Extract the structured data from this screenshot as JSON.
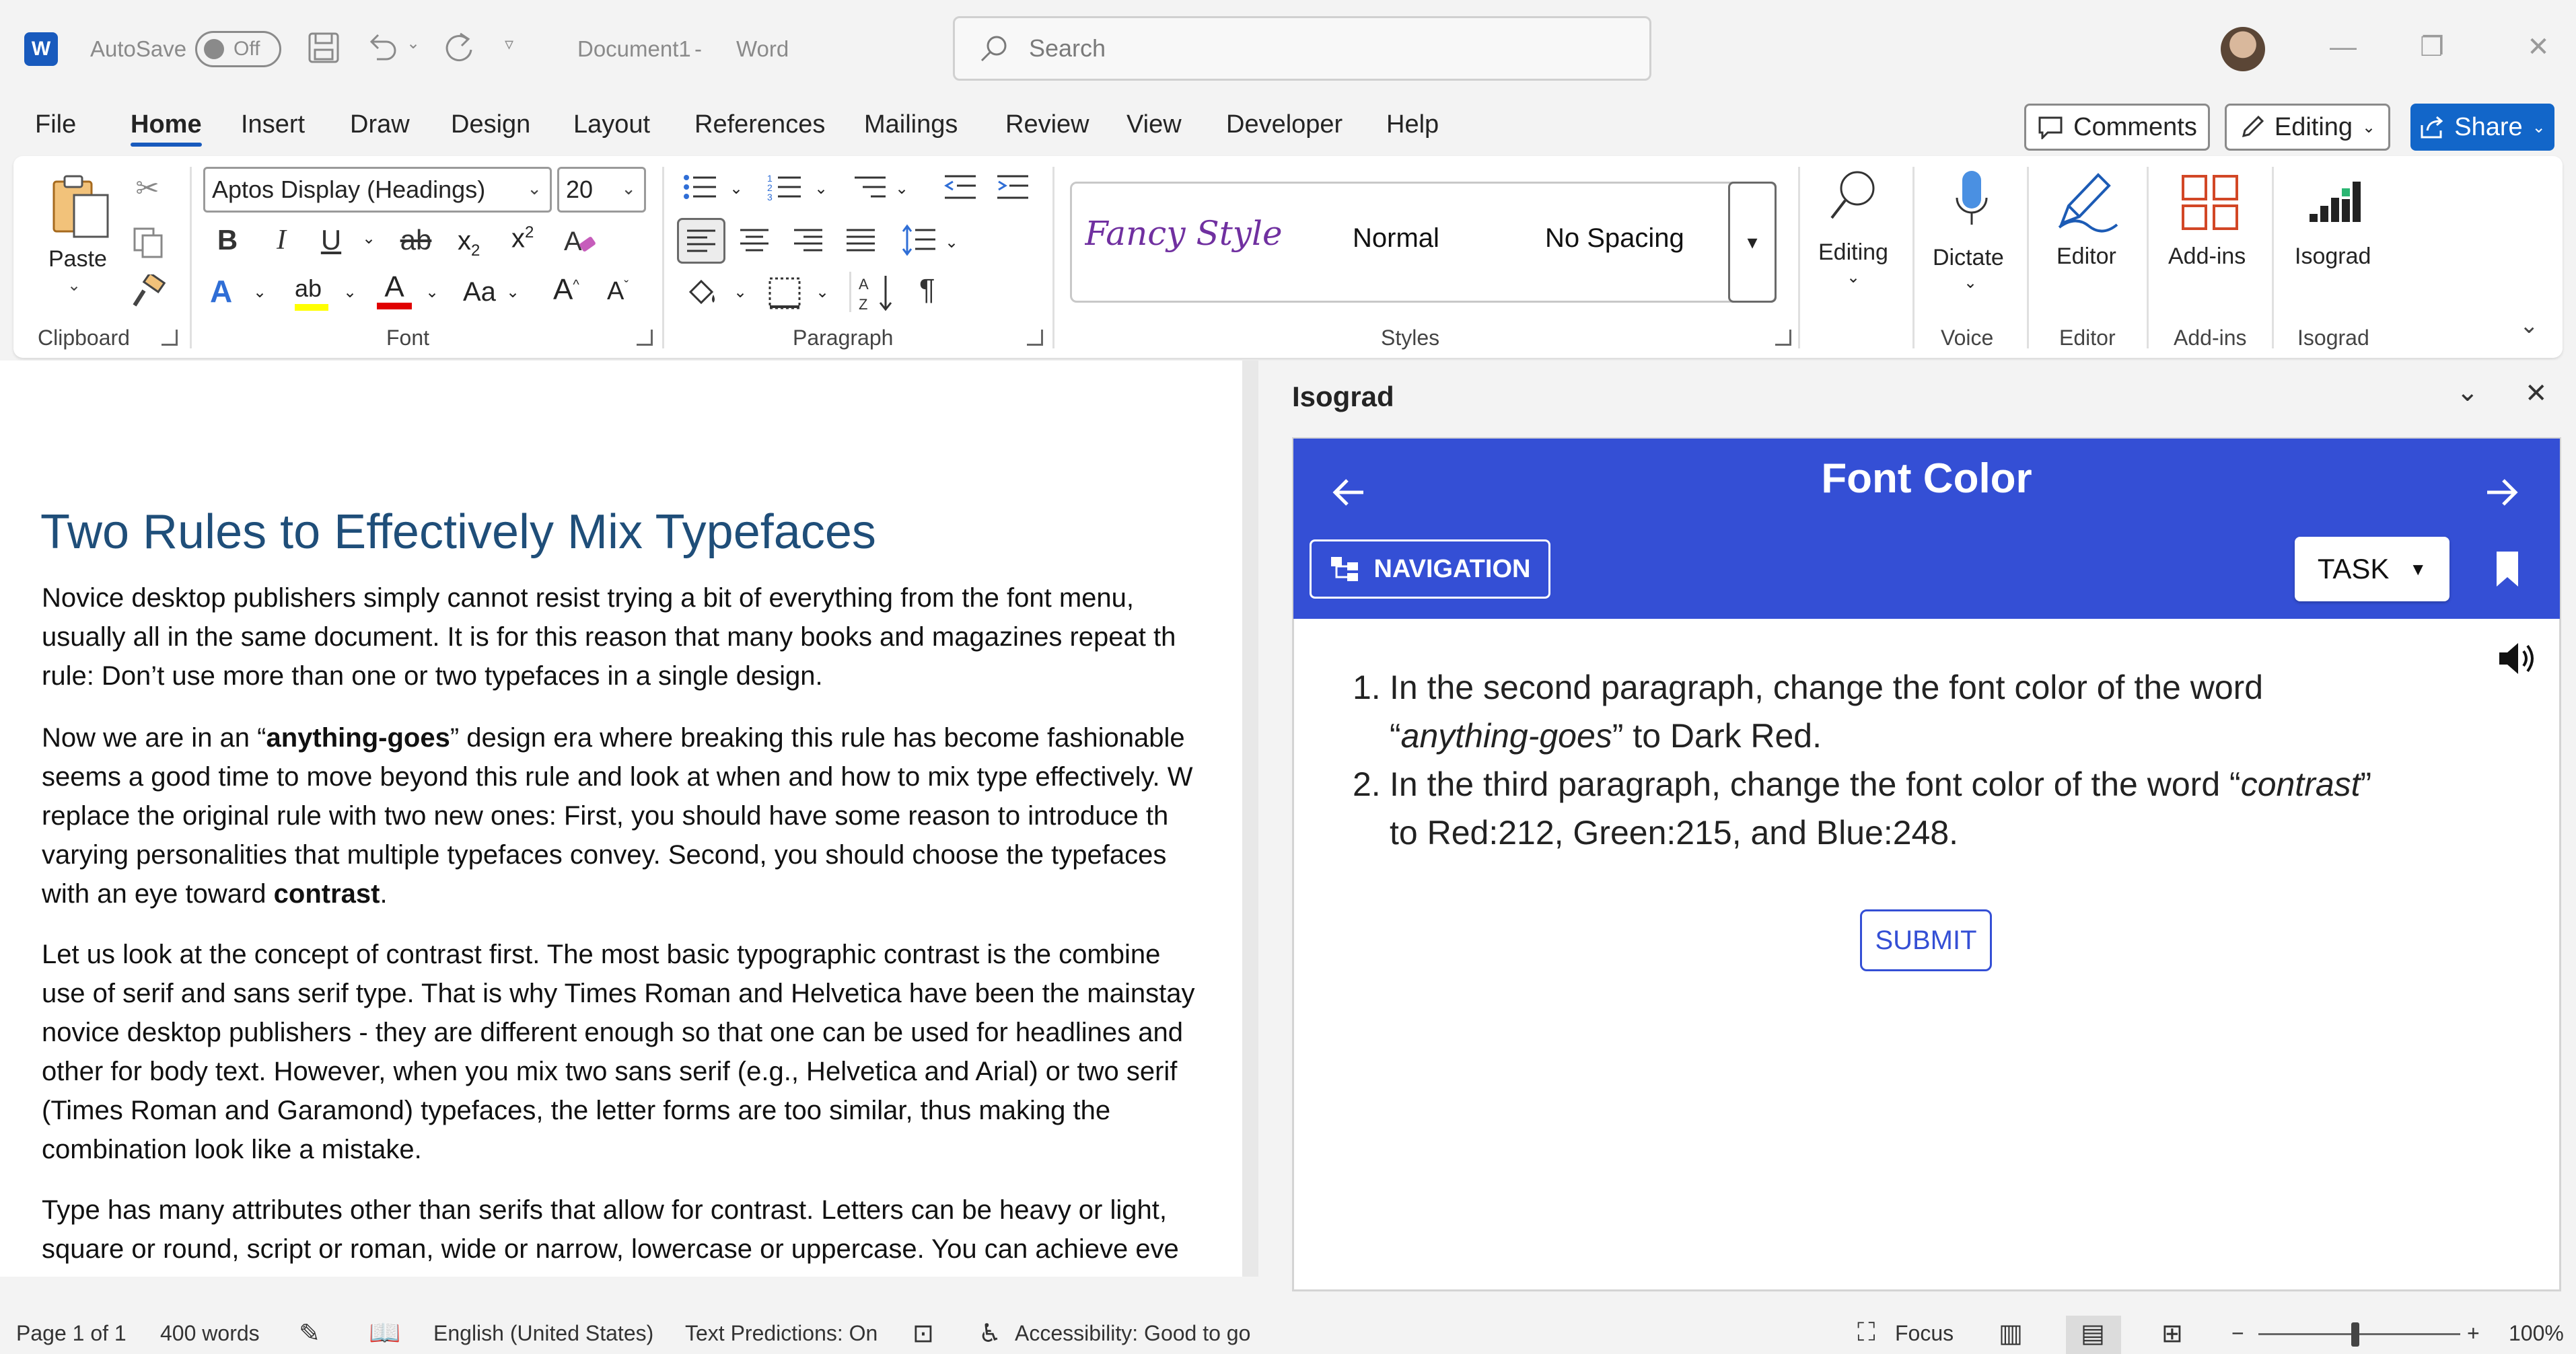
{
  "titlebar": {
    "app_icon": "W",
    "autosave_label": "AutoSave",
    "autosave_state": "Off",
    "doc_title": "Document1",
    "title_sep": "-",
    "app_name": "Word",
    "search_placeholder": "Search"
  },
  "menu": {
    "tabs": [
      "File",
      "Home",
      "Insert",
      "Draw",
      "Design",
      "Layout",
      "References",
      "Mailings",
      "Review",
      "View",
      "Developer",
      "Help"
    ],
    "active_tab": "Home",
    "comments_label": "Comments",
    "editing_label": "Editing",
    "share_label": "Share"
  },
  "ribbon": {
    "clipboard": {
      "paste_label": "Paste",
      "group_label": "Clipboard"
    },
    "font": {
      "font_name": "Aptos Display (Headings)",
      "font_size": "20",
      "group_label": "Font",
      "bold": "B",
      "italic": "I",
      "underline": "U",
      "strike": "ab",
      "sub": "x",
      "sub_mark": "2",
      "sup": "x",
      "sup_mark": "2",
      "case_label": "Aa",
      "grow": "A",
      "shrink": "A",
      "effects": "A",
      "highlight": "ab",
      "color": "A"
    },
    "paragraph": {
      "group_label": "Paragraph",
      "pilcrow": "¶"
    },
    "styles": {
      "items": [
        "Fancy Style",
        "Normal",
        "No Spacing"
      ],
      "group_label": "Styles"
    },
    "editing": {
      "label": "Editing"
    },
    "voice": {
      "label": "Dictate",
      "group_label": "Voice"
    },
    "editor": {
      "label": "Editor",
      "group_label": "Editor"
    },
    "addins": {
      "label": "Add-ins",
      "group_label": "Add-ins"
    },
    "isograd": {
      "label": "Isograd",
      "group_label": "Isograd"
    }
  },
  "document": {
    "heading": "Two Rules to Effectively Mix Typefaces",
    "p1": [
      "Novice desktop publishers simply cannot resist trying a bit of everything from the font menu,",
      "usually all in the same document. It is for this reason that many books and magazines repeat th",
      "rule: Don’t use more than one or two typefaces in a single design."
    ],
    "p2": {
      "l1_pre": "Now we are in an “",
      "l1_bold": "anything-goes",
      "l1_post": "” design era where breaking this rule has become fashionable",
      "l2": "seems a good time to move beyond this rule and look at when and how to mix type effectively. W",
      "l3": "replace the original rule with two new ones: First, you should have some reason to introduce th",
      "l4": "varying personalities that multiple typefaces convey. Second, you should choose the typefaces",
      "l5_pre": "with an eye toward ",
      "l5_bold": "contrast",
      "l5_post": "."
    },
    "p3": [
      "Let us look at the concept of contrast first. The most basic typographic contrast is the combine",
      "use of serif and sans serif type. That is why Times Roman and Helvetica have been the mainstay",
      "novice desktop publishers - they are different enough so that one can be used for headlines and",
      "other for body text. However, when you mix two sans serif (e.g., Helvetica and Arial) or two serif",
      "(Times Roman and Garamond) typefaces, the letter forms are too similar, thus making the",
      "combination look like a mistake."
    ],
    "p4": [
      "Type has many attributes other than serifs that allow for contrast. Letters can be heavy or light,",
      "square or round, script or roman, wide or narrow, lowercase or uppercase. You can achieve eve"
    ]
  },
  "pane": {
    "title": "Isograd",
    "header_title": "Font Color",
    "navigation_label": "NAVIGATION",
    "task_label": "TASK",
    "tasks": {
      "t1_num": "1.",
      "t1_a": "In the second paragraph, change the font color of the word",
      "t1_q_open": "“",
      "t1_italic": "anything-goes",
      "t1_q_close": "”",
      "t1_b": " to Dark Red.",
      "t2_num": "2.",
      "t2_a": "In the third paragraph, change the font color of the word “",
      "t2_italic": "contrast",
      "t2_q_close": "”",
      "t2_b": "to Red:212, Green:215, and Blue:248."
    },
    "submit_label": "SUBMIT"
  },
  "statusbar": {
    "page": "Page 1 of 1",
    "words": "400 words",
    "language": "English (United States)",
    "predictions": "Text Predictions: On",
    "accessibility": "Accessibility: Good to go",
    "focus": "Focus",
    "zoom_minus": "−",
    "zoom_plus": "+",
    "zoom": "100%"
  },
  "colors": {
    "word_blue": "#185abd",
    "share_blue": "#1266c9",
    "isograd_header": "#344fd5",
    "heading_blue": "#1f4e79",
    "fancy_style_purple": "#7030a0",
    "font_color_red": "#e00000",
    "highlight_yellow": "#ffff00"
  },
  "icons": [
    "word-logo-icon",
    "save-icon",
    "undo-icon",
    "redo-icon",
    "customize-icon",
    "search-icon",
    "minimize-icon",
    "restore-icon",
    "close-icon",
    "paste-icon",
    "cut-icon",
    "copy-icon",
    "format-painter-icon",
    "clear-format-icon",
    "bullets-icon",
    "numbering-icon",
    "multilevel-icon",
    "decrease-indent-icon",
    "increase-indent-icon",
    "align-left-icon",
    "center-icon",
    "align-right-icon",
    "justify-icon",
    "line-spacing-icon",
    "shading-icon",
    "borders-icon",
    "sort-icon",
    "pilcrow-icon",
    "find-icon",
    "microphone-icon",
    "editor-pen-icon",
    "addins-grid-icon",
    "isograd-bars-icon",
    "back-arrow-icon",
    "forward-arrow-icon",
    "navigation-tree-icon",
    "bookmark-icon",
    "speaker-icon"
  ]
}
